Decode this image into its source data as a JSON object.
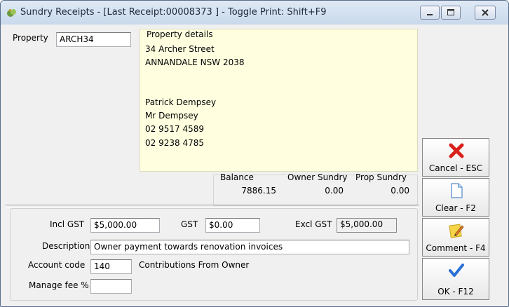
{
  "window": {
    "title": "Sundry Receipts - [Last Receipt:00008373 ] - Toggle Print: Shift+F9"
  },
  "property": {
    "label": "Property",
    "value": "ARCH34"
  },
  "details": {
    "legend": "Property details",
    "address_line1": "34 Archer Street",
    "address_line2": "ANNANDALE  NSW  2038",
    "contact_name": "Patrick Dempsey",
    "salutation": "Mr Dempsey",
    "phone1": "02 9517 4589",
    "phone2": "02 9238 4785"
  },
  "balances": {
    "balance_label": "Balance",
    "balance_value": "7886.15",
    "owner_sundry_label": "Owner Sundry",
    "owner_sundry_value": "0.00",
    "prop_sundry_label": "Prop Sundry",
    "prop_sundry_value": "0.00"
  },
  "form": {
    "incl_gst_label": "Incl GST",
    "incl_gst_value": "$5,000.00",
    "gst_label": "GST",
    "gst_value": "$0.00",
    "excl_gst_label": "Excl GST",
    "excl_gst_value": "$5,000.00",
    "description_label": "Description",
    "description_value": "Owner payment towards renovation invoices",
    "account_code_label": "Account code",
    "account_code_value": "140",
    "account_name": "Contributions From Owner",
    "manage_fee_label": "Manage fee %",
    "manage_fee_value": ""
  },
  "actions": {
    "cancel_label": "Cancel - ESC",
    "clear_label": "Clear - F2",
    "comment_label": "Comment - F4",
    "ok_label": "OK - F12"
  },
  "icons": {
    "app": "app-icon",
    "cancel": "red-x-icon",
    "clear": "blank-page-icon",
    "comment": "note-pencil-icon",
    "ok": "check-icon"
  },
  "colors": {
    "details_bg": "#ffffe0",
    "cancel_red": "#d9201c",
    "ok_blue": "#2a6fd6"
  }
}
